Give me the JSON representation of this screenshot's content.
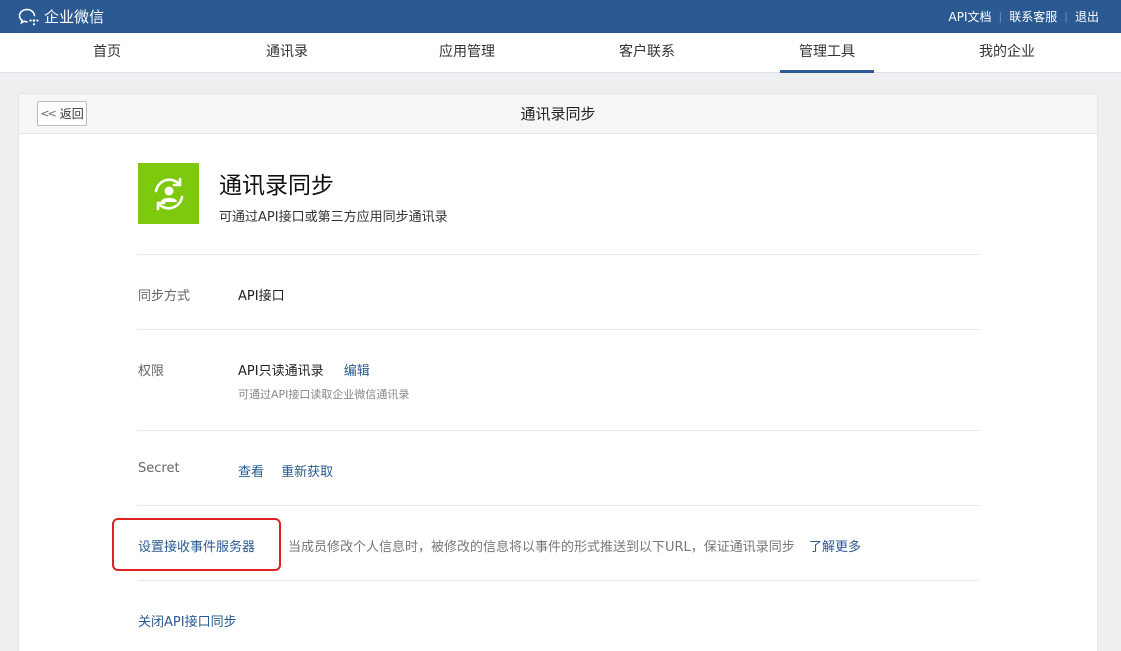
{
  "topbar": {
    "brand": "企业微信",
    "links": [
      "API文档",
      "联系客服",
      "退出"
    ]
  },
  "nav": {
    "tabs": [
      "首页",
      "通讯录",
      "应用管理",
      "客户联系",
      "管理工具",
      "我的企业"
    ],
    "active_index": 4
  },
  "card": {
    "back_label": "返回",
    "title": "通讯录同步"
  },
  "app": {
    "name": "通讯录同步",
    "description": "可通过API接口或第三方应用同步通讯录",
    "icon": "contacts-sync-icon",
    "icon_color": "#7dc90e"
  },
  "sync_method": {
    "label": "同步方式",
    "value": "API接口"
  },
  "permission": {
    "label": "权限",
    "value": "API只读通讯录",
    "edit_label": "编辑",
    "hint": "可通过API接口读取企业微信通讯录"
  },
  "secret": {
    "label": "Secret",
    "view_label": "查看",
    "refresh_label": "重新获取"
  },
  "event_server": {
    "link_label": "设置接收事件服务器",
    "description": "当成员修改个人信息时，被修改的信息将以事件的形式推送到以下URL，保证通讯录同步",
    "learn_more": "了解更多"
  },
  "close_sync": "关闭API接口同步",
  "colors": {
    "topbar": "#2b5a93",
    "link": "#2b5a93",
    "highlight": "#e02020"
  }
}
